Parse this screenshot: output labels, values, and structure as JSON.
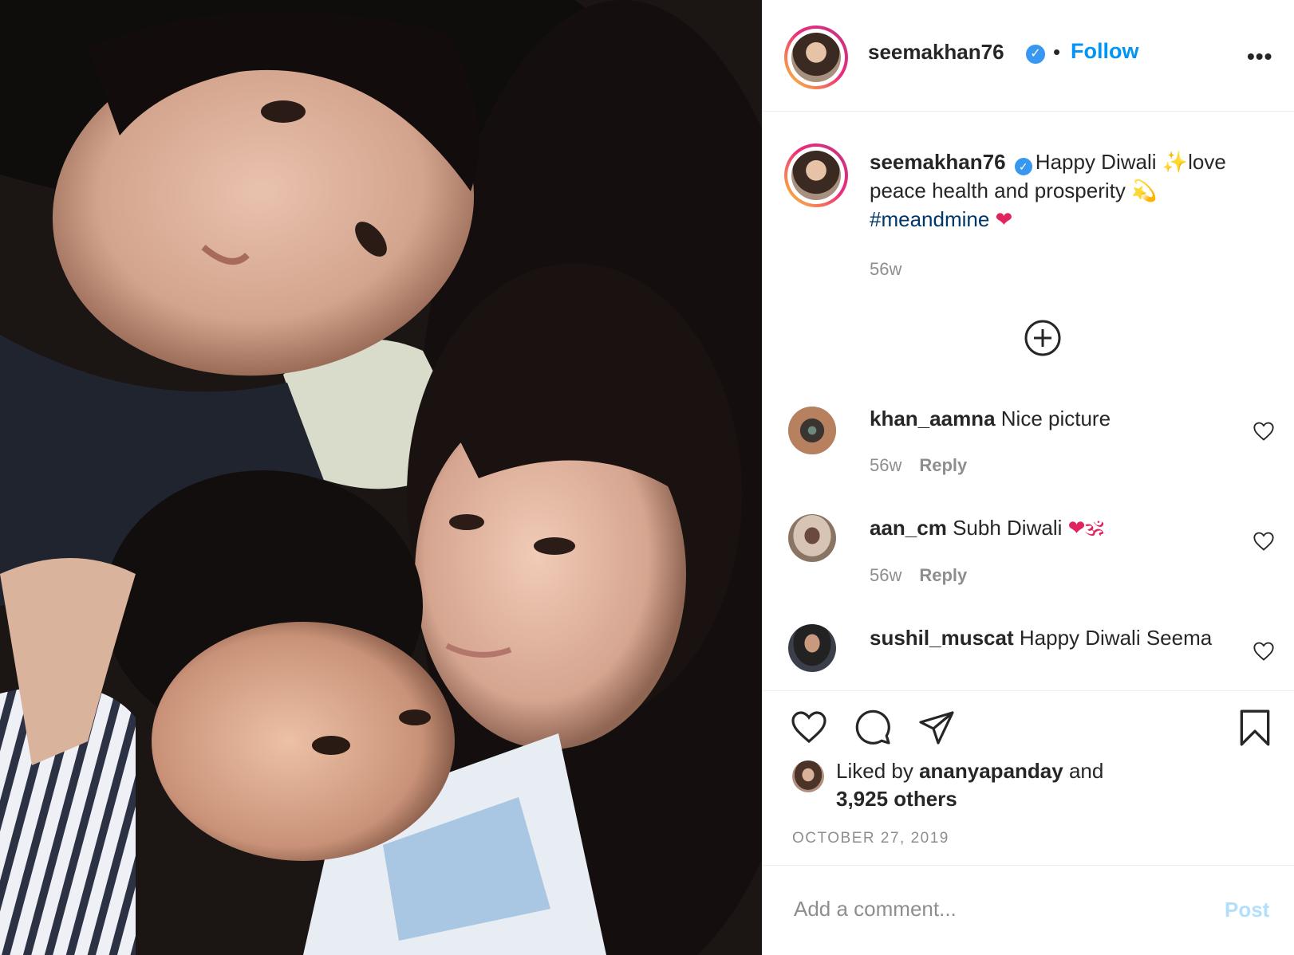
{
  "header": {
    "username": "seemakhan76",
    "verified_mark": "✓",
    "separator": "•",
    "follow_label": "Follow",
    "more_label": "•••"
  },
  "caption": {
    "username": "seemakhan76",
    "text_start": "Happy Diwali ",
    "sparkles": "✨",
    "text_mid": "love peace health and prosperity ",
    "dizzy": "💫",
    "hashtag": "#meandmine",
    "heart": "❤",
    "time": "56w"
  },
  "comments": [
    {
      "username": "khan_aamna",
      "text": "Nice picture",
      "time": "56w",
      "reply": "Reply"
    },
    {
      "username": "aan_cm",
      "text": "Subh Diwali ",
      "emoji": "❤🕉",
      "time": "56w",
      "reply": "Reply"
    },
    {
      "username": "sushil_muscat",
      "text": "Happy Diwali Seema"
    }
  ],
  "likes": {
    "prefix": "Liked by",
    "liker": "ananyapanday",
    "middle": "and",
    "others": "3,925 others"
  },
  "date": "OCTOBER 27, 2019",
  "comment_box": {
    "placeholder": "Add a comment...",
    "post_label": "Post"
  },
  "icons": [
    "verified-badge-icon",
    "more-icon",
    "add-comments-icon",
    "heart-outline-icon",
    "comment-icon",
    "share-icon",
    "bookmark-icon"
  ],
  "colors": {
    "accent": "#0095f6",
    "hashtag": "#00376b",
    "muted": "#8e8e8e",
    "post_disabled": "#b2dffc"
  }
}
